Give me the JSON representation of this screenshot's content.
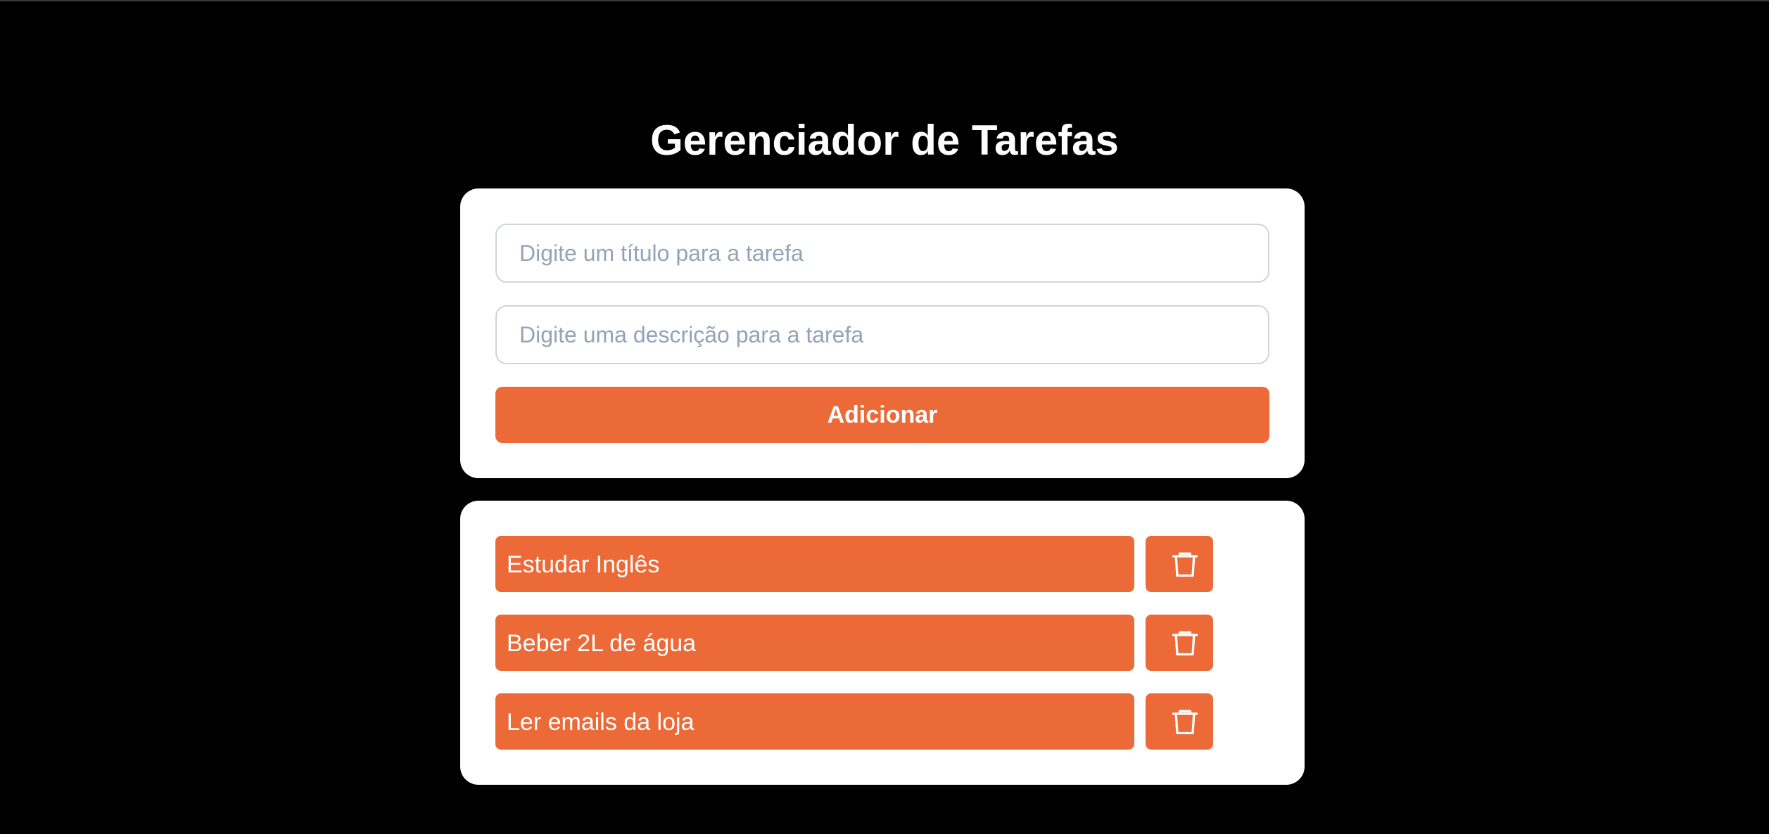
{
  "header": {
    "title": "Gerenciador de Tarefas"
  },
  "form": {
    "title_placeholder": "Digite um título para a tarefa",
    "title_value": "",
    "description_placeholder": "Digite uma descrição para a tarefa",
    "description_value": "",
    "add_label": "Adicionar"
  },
  "tasks": [
    {
      "title": "Estudar Inglês",
      "details_icon": "chevron-right-icon",
      "delete_icon": "trash-icon"
    },
    {
      "title": "Beber 2L de água",
      "details_icon": "chevron-right-icon",
      "delete_icon": "trash-icon"
    },
    {
      "title": "Ler emails da loja",
      "details_icon": "chevron-right-icon",
      "delete_icon": "trash-icon"
    }
  ],
  "colors": {
    "background": "#000000",
    "card": "#ffffff",
    "accent": "#ec6a37",
    "input_border": "#d1d5db",
    "placeholder": "#94a3b8"
  }
}
